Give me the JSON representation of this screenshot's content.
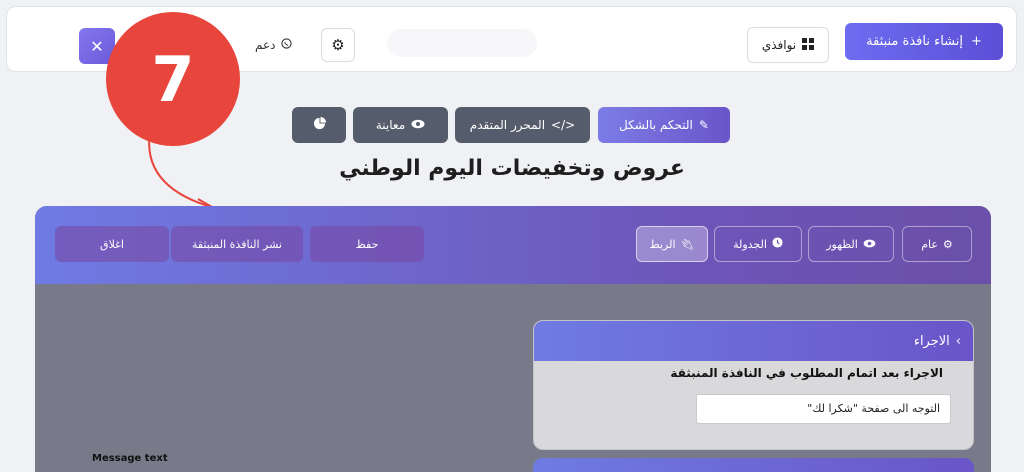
{
  "topbar": {
    "create_label": "إنشاء نافذة منبثقة",
    "windows_label": "نوافذي",
    "support_label": "دعم",
    "close_glyph": "✕"
  },
  "badge": {
    "number": "7"
  },
  "tabs": [
    {
      "label": "التحكم بالشكل",
      "icon": "pencil-icon"
    },
    {
      "label": "المحرر المتقدم",
      "icon": "code-icon"
    },
    {
      "label": "معاينة",
      "icon": "eye-icon"
    },
    {
      "label": "",
      "icon": "pie-chart-icon"
    }
  ],
  "page_title": "عروض وتخفيضات اليوم الوطني",
  "editor": {
    "buttons": {
      "general": "عام",
      "appearance": "الظهور",
      "schedule": "الجدولة",
      "link": "الربط",
      "save": "حفظ",
      "publish": "نشر النافذة المنبثقة",
      "close": "اغلاق"
    }
  },
  "action_card": {
    "header": "الاجراء",
    "description": "الاجراء بعد اتمام المطلوب في النافذة المنبثقة",
    "select_value": "التوجه الى صفحة \"شكرا لك\""
  },
  "message_label": "Message text",
  "colors": {
    "accent": "#6a55c8",
    "badge": "#e8453c"
  }
}
